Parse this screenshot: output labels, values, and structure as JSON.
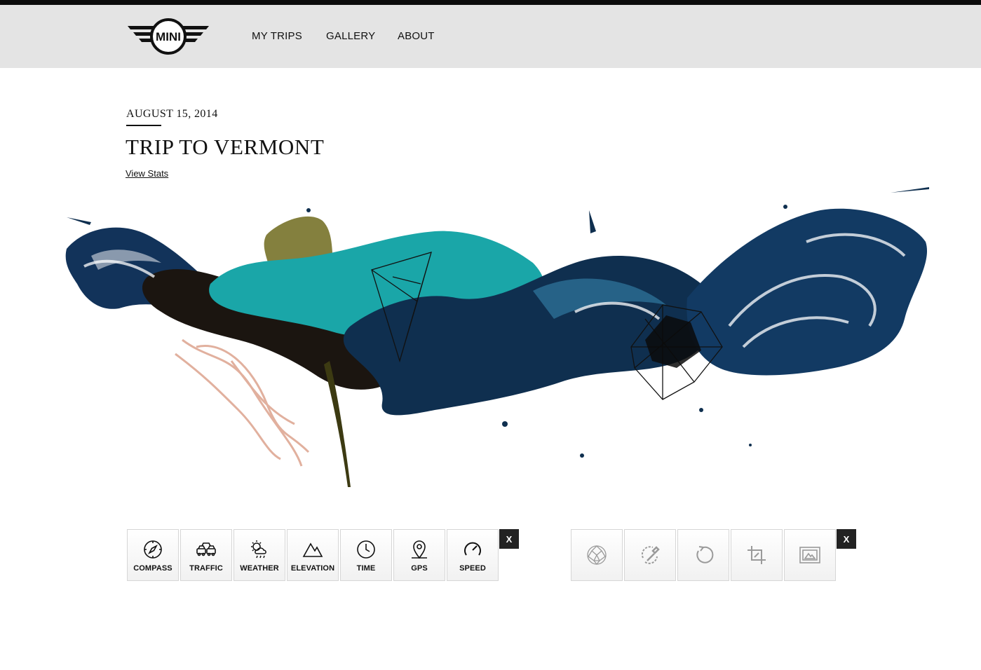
{
  "brand": {
    "logo_text": "MINI"
  },
  "nav": {
    "items": [
      "MY TRIPS",
      "GALLERY",
      "ABOUT"
    ]
  },
  "trip": {
    "date": "AUGUST 15, 2014",
    "title": "TRIP TO VERMONT",
    "view_stats": "View Stats"
  },
  "data_toolbar": {
    "tools": [
      {
        "label": "COMPASS",
        "icon": "compass-icon"
      },
      {
        "label": "TRAFFIC",
        "icon": "traffic-icon"
      },
      {
        "label": "WEATHER",
        "icon": "weather-icon"
      },
      {
        "label": "ELEVATION",
        "icon": "elevation-icon"
      },
      {
        "label": "TIME",
        "icon": "clock-icon"
      },
      {
        "label": "GPS",
        "icon": "map-pin-icon"
      },
      {
        "label": "SPEED",
        "icon": "speedometer-icon"
      }
    ],
    "close_label": "X"
  },
  "edit_toolbar": {
    "tools": [
      {
        "icon": "geodesic-sphere-icon"
      },
      {
        "icon": "color-picker-icon"
      },
      {
        "icon": "rotate-icon"
      },
      {
        "icon": "crop-icon"
      },
      {
        "icon": "image-frame-icon"
      }
    ],
    "close_label": "X"
  },
  "colors": {
    "header_bg": "#e4e4e4",
    "topbar": "#0c0c0c",
    "ink_navy": "#0f2f4f",
    "ink_teal": "#1aa6a8",
    "ink_olive": "#6f6a1c",
    "ink_rust": "#c9704f"
  }
}
